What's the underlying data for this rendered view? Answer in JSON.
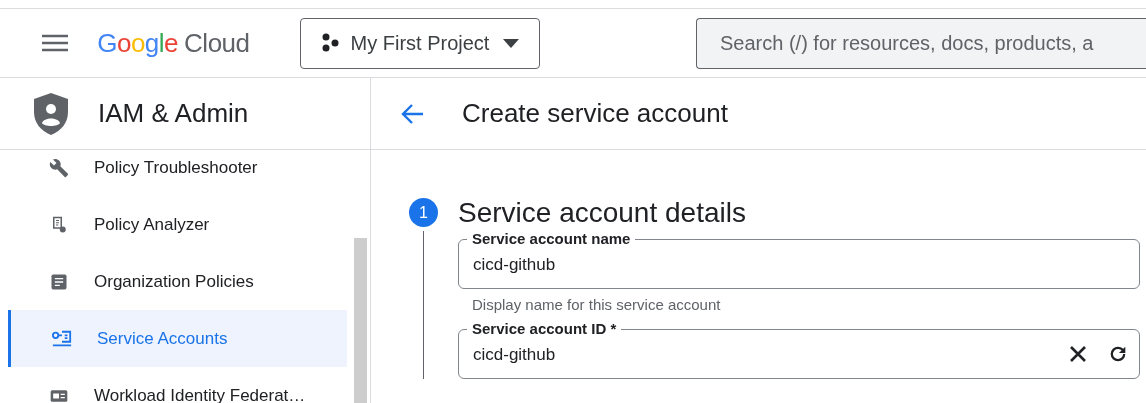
{
  "header": {
    "logo": {
      "brand": "Google",
      "product": "Cloud"
    },
    "project": "My First Project",
    "search": {
      "placeholder": "Search (/) for resources, docs, products, a"
    }
  },
  "sidebar": {
    "title": "IAM & Admin",
    "items": [
      {
        "label": "Policy Troubleshooter",
        "kind": "wrench",
        "selected": false
      },
      {
        "label": "Policy Analyzer",
        "kind": "report",
        "selected": false
      },
      {
        "label": "Organization Policies",
        "kind": "document",
        "selected": false
      },
      {
        "label": "Service Accounts",
        "kind": "account",
        "selected": true
      },
      {
        "label": "Workload Identity Federat…",
        "kind": "card",
        "selected": false
      }
    ]
  },
  "page": {
    "title": "Create service account",
    "step": {
      "number": "1",
      "title": "Service account details",
      "fields": [
        {
          "label": "Service account name",
          "value": "cicd-github",
          "helper": "Display name for this service account",
          "actions": false
        },
        {
          "label": "Service account ID *",
          "value": "cicd-github",
          "actions": true
        }
      ]
    }
  }
}
